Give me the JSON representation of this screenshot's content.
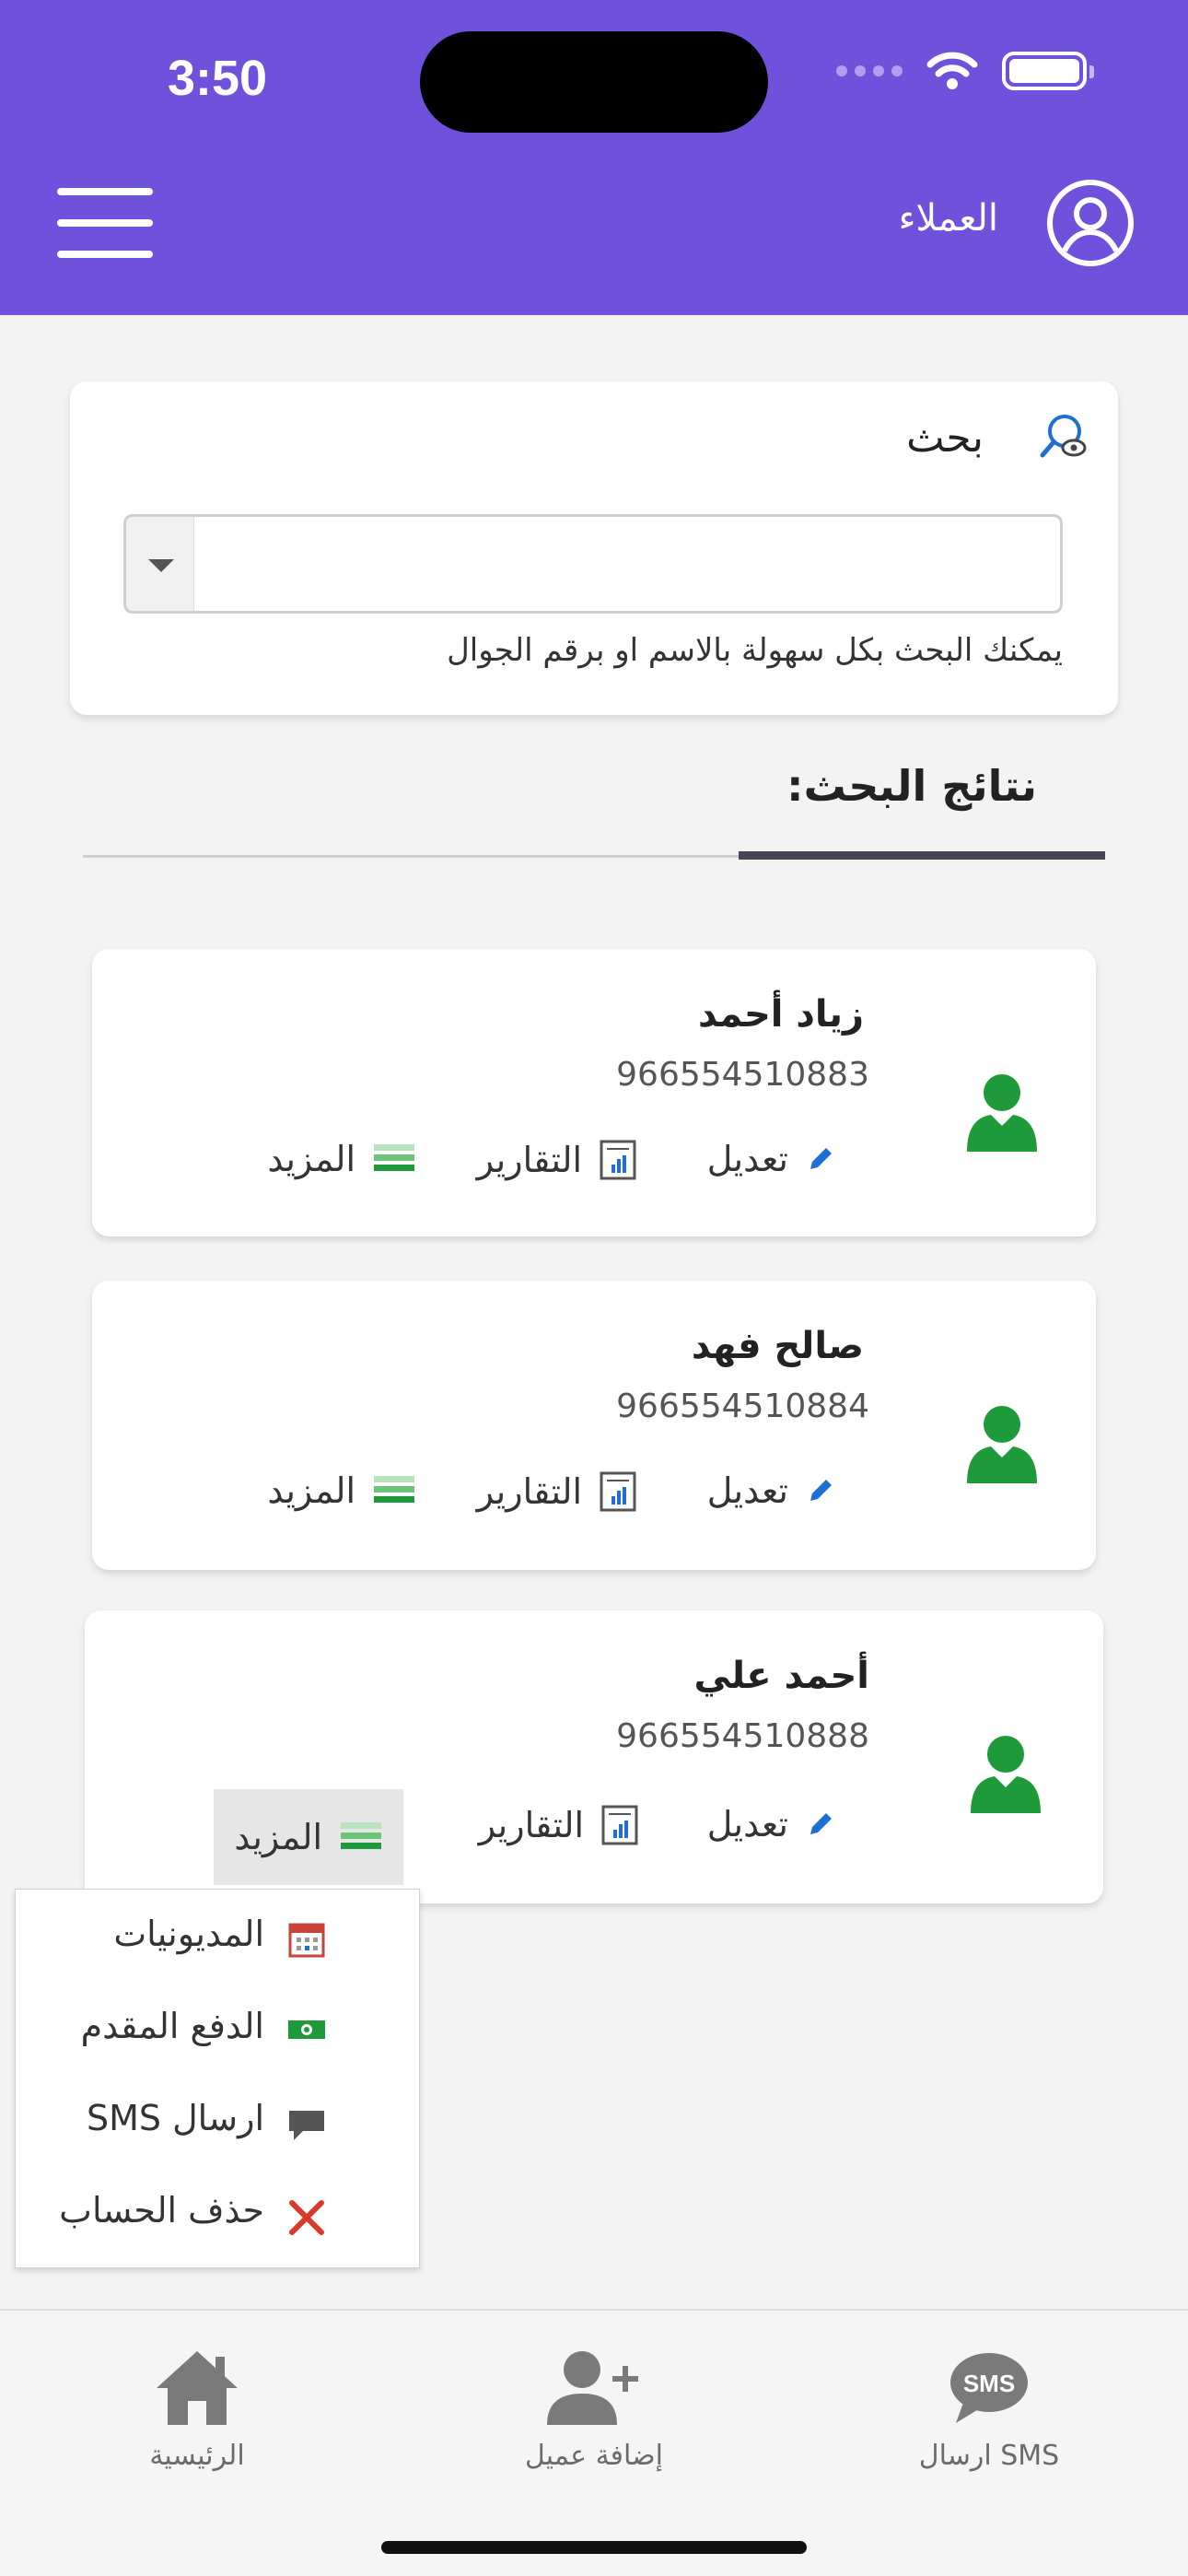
{
  "status_bar": {
    "time": "3:50"
  },
  "header": {
    "title": "العملاء"
  },
  "search": {
    "title": "بحث",
    "input_value": "",
    "input_placeholder": "",
    "hint": "يمكنك البحث بكل سهولة بالاسم او برقم الجوال"
  },
  "results": {
    "title": "نتائج البحث:",
    "clients": [
      {
        "name": "زياد أحمد",
        "phone": "966554510883",
        "edit": "تعديل",
        "reports": "التقارير",
        "more": "المزيد"
      },
      {
        "name": "صالح فهد",
        "phone": "966554510884",
        "edit": "تعديل",
        "reports": "التقارير",
        "more": "المزيد"
      },
      {
        "name": "أحمد علي",
        "phone": "966554510888",
        "edit": "تعديل",
        "reports": "التقارير",
        "more": "المزيد"
      }
    ]
  },
  "more_menu": {
    "items": [
      {
        "label": "المديونيات",
        "icon": "calendar-icon"
      },
      {
        "label": "الدفع المقدم",
        "icon": "cash-icon"
      },
      {
        "label": "ارسال SMS",
        "icon": "message-icon"
      },
      {
        "label": "حذف الحساب",
        "icon": "delete-icon"
      }
    ]
  },
  "tabbar": {
    "home": "الرئيسية",
    "add_client": "إضافة عميل",
    "send_sms": "ارسال SMS",
    "sms_badge": "SMS"
  },
  "colors": {
    "header": "#6f51dc",
    "user_icon": "#1f9a3a",
    "edit_icon": "#1e6fd4",
    "delete_icon": "#d93a2b"
  }
}
